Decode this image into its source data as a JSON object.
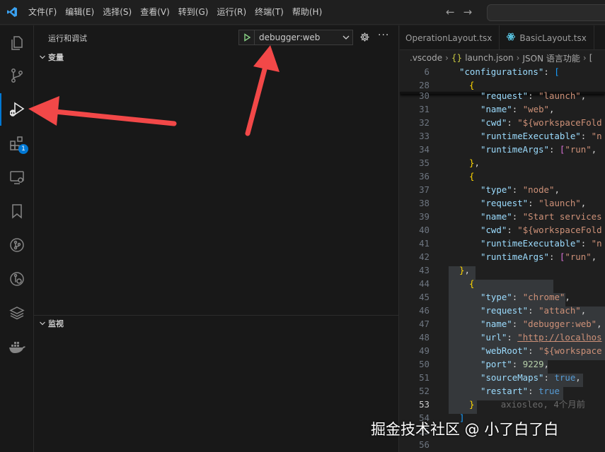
{
  "menu": [
    "文件(F)",
    "编辑(E)",
    "选择(S)",
    "查看(V)",
    "转到(G)",
    "运行(R)",
    "终端(T)",
    "帮助(H)"
  ],
  "activity": {
    "extensions_badge": "1"
  },
  "sidebar": {
    "title": "运行和调试",
    "config_name": "debugger:web",
    "variables_label": "变量",
    "watch_label": "监视"
  },
  "tabs": [
    {
      "label": "OperationLayout.tsx",
      "icon": "TS"
    },
    {
      "label": "BasicLayout.tsx",
      "icon": "TS"
    }
  ],
  "breadcrumb": {
    "folder": ".vscode",
    "file": "launch.json",
    "feature": "JSON 语言功能",
    "trail": "[",
    "json_icon": "{}"
  },
  "code_lines": {
    "l6": "6",
    "l28": "28",
    "l30": "30",
    "l31": "31",
    "l32": "32",
    "l33": "33",
    "l34": "34",
    "l35": "35",
    "l36": "36",
    "l37": "37",
    "l38": "38",
    "l39": "39",
    "l40": "40",
    "l41": "41",
    "l42": "42",
    "l43": "43",
    "l44": "44",
    "l45": "45",
    "l46": "46",
    "l47": "47",
    "l48": "48",
    "l49": "49",
    "l50": "50",
    "l51": "51",
    "l52": "52",
    "l53": "53",
    "l54": "54",
    "l55": "55",
    "l56": "56"
  },
  "code_text": {
    "configurations": "\"configurations\"",
    "request": "\"request\"",
    "launch": "\"launch\"",
    "name": "\"name\"",
    "web": "\"web\"",
    "cwd": "\"cwd\"",
    "workspace_fold": "\"${workspaceFold",
    "workspace": "\"${workspace",
    "runtimeExecutable": "\"runtimeExecutable\"",
    "runtimeArgs": "\"runtimeArgs\"",
    "run": "\"run\"",
    "n": "\"n",
    "type": "\"type\"",
    "node": "\"node\"",
    "start_services": "\"Start services",
    "chrome": "\"chrome\"",
    "attach": "\"attach\"",
    "debugger_web": "\"debugger:web\"",
    "url": "\"url\"",
    "url_value": "\"http://localhos",
    "webRoot": "\"webRoot\"",
    "port": "\"port\"",
    "port_value": "9229",
    "sourceMaps": "\"sourceMaps\"",
    "restart": "\"restart\"",
    "true": "true",
    "blame": "axiosleo, 4个月前"
  },
  "watermark": "掘金技术社区 @ 小了白了白",
  "colors": {
    "accent": "#0078d4",
    "arrow": "#f24848",
    "play_green": "#89d185"
  }
}
